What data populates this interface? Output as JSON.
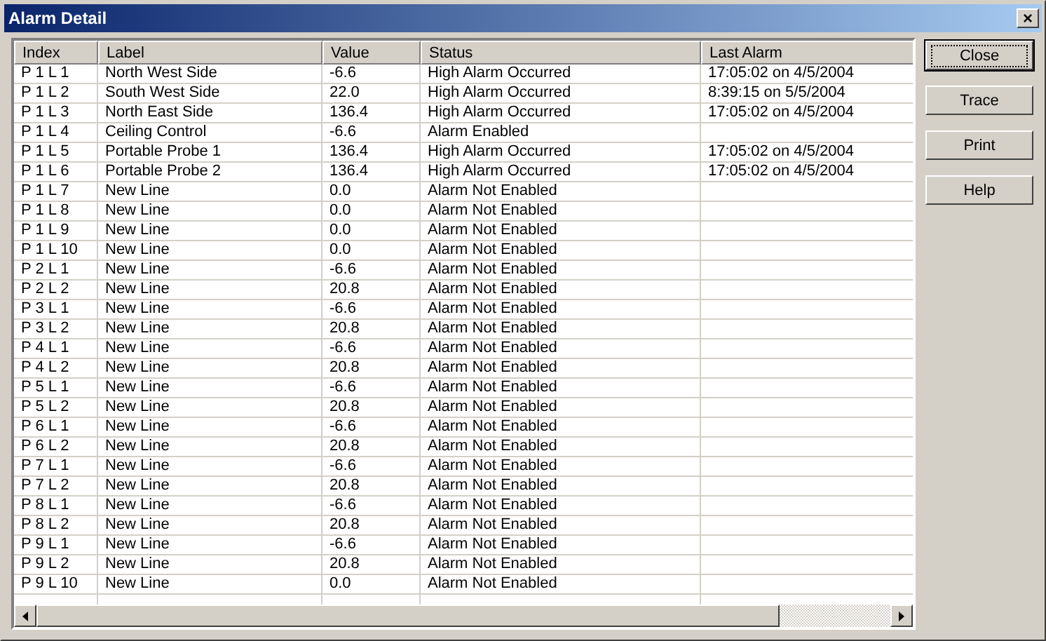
{
  "window": {
    "title": "Alarm Detail",
    "close_glyph": "×"
  },
  "table": {
    "columns": [
      "Index",
      "Label",
      "Value",
      "Status",
      "Last Alarm"
    ],
    "rows": [
      {
        "index": "P 1 L 1",
        "label": "North West Side",
        "value": "-6.6",
        "status": "High Alarm Occurred",
        "last_alarm": "17:05:02 on 4/5/2004"
      },
      {
        "index": "P 1 L 2",
        "label": "South West Side",
        "value": "22.0",
        "status": "High Alarm Occurred",
        "last_alarm": "8:39:15 on 5/5/2004"
      },
      {
        "index": "P 1 L 3",
        "label": "North East Side",
        "value": "136.4",
        "status": "High Alarm Occurred",
        "last_alarm": "17:05:02 on 4/5/2004"
      },
      {
        "index": "P 1 L 4",
        "label": "Ceiling Control",
        "value": "-6.6",
        "status": "Alarm Enabled"
      },
      {
        "index": "P 1 L 5",
        "label": "Portable Probe 1",
        "value": "136.4",
        "status": "High Alarm Occurred",
        "last_alarm": "17:05:02 on 4/5/2004"
      },
      {
        "index": "P 1 L 6",
        "label": "Portable Probe 2",
        "value": "136.4",
        "status": "High Alarm Occurred",
        "last_alarm": "17:05:02 on 4/5/2004"
      },
      {
        "index": "P 1 L 7",
        "label": "New Line",
        "value": "0.0",
        "status": "Alarm Not Enabled"
      },
      {
        "index": "P 1 L 8",
        "label": "New Line",
        "value": "0.0",
        "status": "Alarm Not Enabled"
      },
      {
        "index": "P 1 L 9",
        "label": "New Line",
        "value": "0.0",
        "status": "Alarm Not Enabled"
      },
      {
        "index": "P 1 L 10",
        "label": "New Line",
        "value": "0.0",
        "status": "Alarm Not Enabled"
      },
      {
        "index": "P 2 L 1",
        "label": "New Line",
        "value": "-6.6",
        "status": "Alarm Not Enabled"
      },
      {
        "index": "P 2 L 2",
        "label": "New Line",
        "value": "20.8",
        "status": "Alarm Not Enabled"
      },
      {
        "index": "P 3 L 1",
        "label": "New Line",
        "value": "-6.6",
        "status": "Alarm Not Enabled"
      },
      {
        "index": "P 3 L 2",
        "label": "New Line",
        "value": "20.8",
        "status": "Alarm Not Enabled"
      },
      {
        "index": "P 4 L 1",
        "label": "New Line",
        "value": "-6.6",
        "status": "Alarm Not Enabled"
      },
      {
        "index": "P 4 L 2",
        "label": "New Line",
        "value": "20.8",
        "status": "Alarm Not Enabled"
      },
      {
        "index": "P 5 L 1",
        "label": "New Line",
        "value": "-6.6",
        "status": "Alarm Not Enabled"
      },
      {
        "index": "P 5 L 2",
        "label": "New Line",
        "value": "20.8",
        "status": "Alarm Not Enabled"
      },
      {
        "index": "P 6 L 1",
        "label": "New Line",
        "value": "-6.6",
        "status": "Alarm Not Enabled"
      },
      {
        "index": "P 6 L 2",
        "label": "New Line",
        "value": "20.8",
        "status": "Alarm Not Enabled"
      },
      {
        "index": "P 7 L 1",
        "label": "New Line",
        "value": "-6.6",
        "status": "Alarm Not Enabled"
      },
      {
        "index": "P 7 L 2",
        "label": "New Line",
        "value": "20.8",
        "status": "Alarm Not Enabled"
      },
      {
        "index": "P 8 L 1",
        "label": "New Line",
        "value": "-6.6",
        "status": "Alarm Not Enabled"
      },
      {
        "index": "P 8 L 2",
        "label": "New Line",
        "value": "20.8",
        "status": "Alarm Not Enabled"
      },
      {
        "index": "P 9 L 1",
        "label": "New Line",
        "value": "-6.6",
        "status": "Alarm Not Enabled"
      },
      {
        "index": "P 9 L 2",
        "label": "New Line",
        "value": "20.8",
        "status": "Alarm Not Enabled"
      },
      {
        "index": "P 9 L 10",
        "label": "New Line",
        "value": "0.0",
        "status": "Alarm Not Enabled"
      }
    ]
  },
  "buttons": [
    {
      "label": "Close",
      "selected": true
    },
    {
      "label": "Trace",
      "selected": false
    },
    {
      "label": "Print",
      "selected": false
    },
    {
      "label": "Help",
      "selected": false
    }
  ]
}
